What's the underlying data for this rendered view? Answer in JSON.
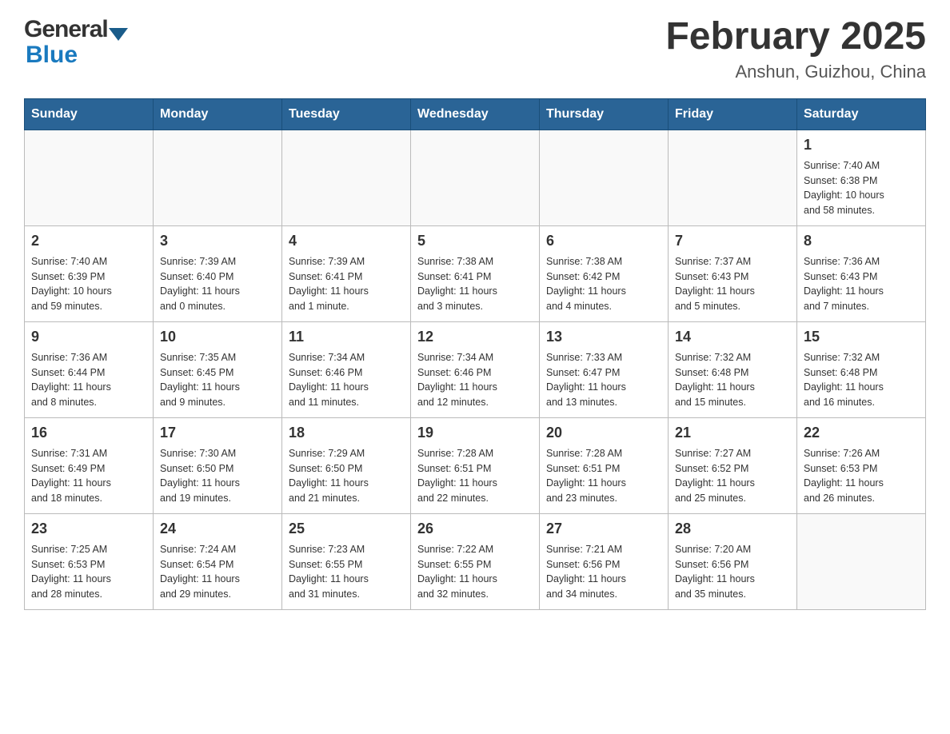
{
  "header": {
    "logo_general": "General",
    "logo_blue": "Blue",
    "month_title": "February 2025",
    "location": "Anshun, Guizhou, China"
  },
  "days_of_week": [
    "Sunday",
    "Monday",
    "Tuesday",
    "Wednesday",
    "Thursday",
    "Friday",
    "Saturday"
  ],
  "weeks": [
    {
      "days": [
        {
          "num": "",
          "info": ""
        },
        {
          "num": "",
          "info": ""
        },
        {
          "num": "",
          "info": ""
        },
        {
          "num": "",
          "info": ""
        },
        {
          "num": "",
          "info": ""
        },
        {
          "num": "",
          "info": ""
        },
        {
          "num": "1",
          "info": "Sunrise: 7:40 AM\nSunset: 6:38 PM\nDaylight: 10 hours\nand 58 minutes."
        }
      ]
    },
    {
      "days": [
        {
          "num": "2",
          "info": "Sunrise: 7:40 AM\nSunset: 6:39 PM\nDaylight: 10 hours\nand 59 minutes."
        },
        {
          "num": "3",
          "info": "Sunrise: 7:39 AM\nSunset: 6:40 PM\nDaylight: 11 hours\nand 0 minutes."
        },
        {
          "num": "4",
          "info": "Sunrise: 7:39 AM\nSunset: 6:41 PM\nDaylight: 11 hours\nand 1 minute."
        },
        {
          "num": "5",
          "info": "Sunrise: 7:38 AM\nSunset: 6:41 PM\nDaylight: 11 hours\nand 3 minutes."
        },
        {
          "num": "6",
          "info": "Sunrise: 7:38 AM\nSunset: 6:42 PM\nDaylight: 11 hours\nand 4 minutes."
        },
        {
          "num": "7",
          "info": "Sunrise: 7:37 AM\nSunset: 6:43 PM\nDaylight: 11 hours\nand 5 minutes."
        },
        {
          "num": "8",
          "info": "Sunrise: 7:36 AM\nSunset: 6:43 PM\nDaylight: 11 hours\nand 7 minutes."
        }
      ]
    },
    {
      "days": [
        {
          "num": "9",
          "info": "Sunrise: 7:36 AM\nSunset: 6:44 PM\nDaylight: 11 hours\nand 8 minutes."
        },
        {
          "num": "10",
          "info": "Sunrise: 7:35 AM\nSunset: 6:45 PM\nDaylight: 11 hours\nand 9 minutes."
        },
        {
          "num": "11",
          "info": "Sunrise: 7:34 AM\nSunset: 6:46 PM\nDaylight: 11 hours\nand 11 minutes."
        },
        {
          "num": "12",
          "info": "Sunrise: 7:34 AM\nSunset: 6:46 PM\nDaylight: 11 hours\nand 12 minutes."
        },
        {
          "num": "13",
          "info": "Sunrise: 7:33 AM\nSunset: 6:47 PM\nDaylight: 11 hours\nand 13 minutes."
        },
        {
          "num": "14",
          "info": "Sunrise: 7:32 AM\nSunset: 6:48 PM\nDaylight: 11 hours\nand 15 minutes."
        },
        {
          "num": "15",
          "info": "Sunrise: 7:32 AM\nSunset: 6:48 PM\nDaylight: 11 hours\nand 16 minutes."
        }
      ]
    },
    {
      "days": [
        {
          "num": "16",
          "info": "Sunrise: 7:31 AM\nSunset: 6:49 PM\nDaylight: 11 hours\nand 18 minutes."
        },
        {
          "num": "17",
          "info": "Sunrise: 7:30 AM\nSunset: 6:50 PM\nDaylight: 11 hours\nand 19 minutes."
        },
        {
          "num": "18",
          "info": "Sunrise: 7:29 AM\nSunset: 6:50 PM\nDaylight: 11 hours\nand 21 minutes."
        },
        {
          "num": "19",
          "info": "Sunrise: 7:28 AM\nSunset: 6:51 PM\nDaylight: 11 hours\nand 22 minutes."
        },
        {
          "num": "20",
          "info": "Sunrise: 7:28 AM\nSunset: 6:51 PM\nDaylight: 11 hours\nand 23 minutes."
        },
        {
          "num": "21",
          "info": "Sunrise: 7:27 AM\nSunset: 6:52 PM\nDaylight: 11 hours\nand 25 minutes."
        },
        {
          "num": "22",
          "info": "Sunrise: 7:26 AM\nSunset: 6:53 PM\nDaylight: 11 hours\nand 26 minutes."
        }
      ]
    },
    {
      "days": [
        {
          "num": "23",
          "info": "Sunrise: 7:25 AM\nSunset: 6:53 PM\nDaylight: 11 hours\nand 28 minutes."
        },
        {
          "num": "24",
          "info": "Sunrise: 7:24 AM\nSunset: 6:54 PM\nDaylight: 11 hours\nand 29 minutes."
        },
        {
          "num": "25",
          "info": "Sunrise: 7:23 AM\nSunset: 6:55 PM\nDaylight: 11 hours\nand 31 minutes."
        },
        {
          "num": "26",
          "info": "Sunrise: 7:22 AM\nSunset: 6:55 PM\nDaylight: 11 hours\nand 32 minutes."
        },
        {
          "num": "27",
          "info": "Sunrise: 7:21 AM\nSunset: 6:56 PM\nDaylight: 11 hours\nand 34 minutes."
        },
        {
          "num": "28",
          "info": "Sunrise: 7:20 AM\nSunset: 6:56 PM\nDaylight: 11 hours\nand 35 minutes."
        },
        {
          "num": "",
          "info": ""
        }
      ]
    }
  ]
}
